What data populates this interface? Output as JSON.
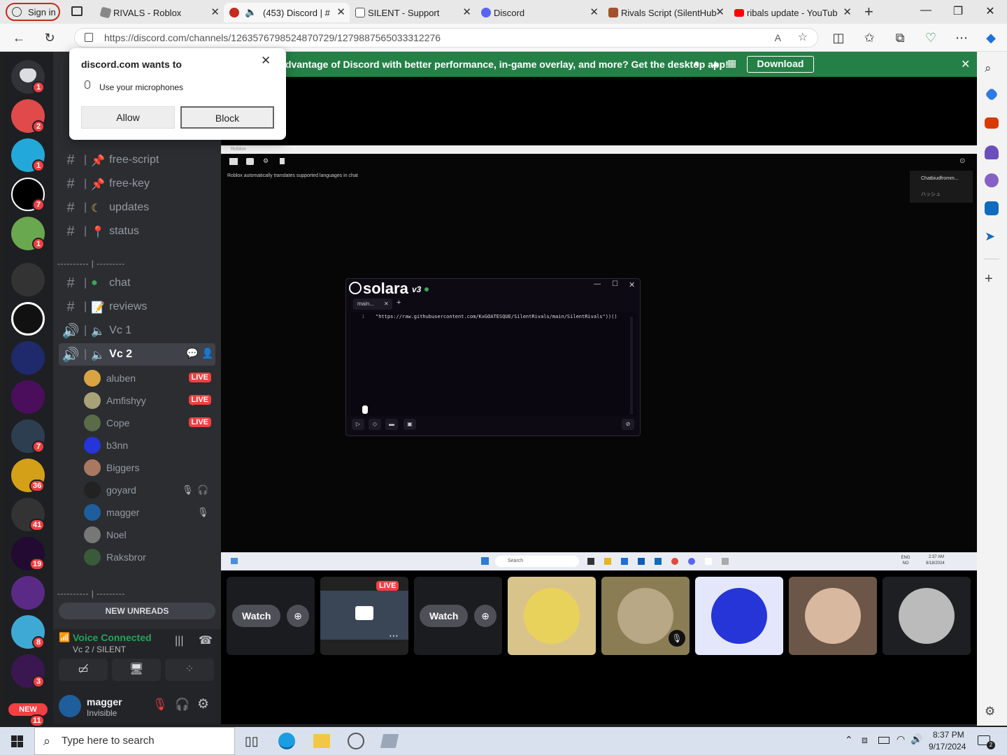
{
  "browser": {
    "signin_label": "Sign in",
    "tabs": [
      {
        "label": "RIVALS - Roblox",
        "color": "#666666"
      },
      {
        "label": "(453) Discord | #",
        "color": "#c42b1c"
      },
      {
        "label": "SILENT - Support",
        "color": "#555555"
      },
      {
        "label": "Discord",
        "color": "#5865f2"
      },
      {
        "label": "Rivals Script (SilentHub",
        "color": "#a0522d"
      },
      {
        "label": "ribals update - YouTub",
        "color": "#ff0000"
      }
    ],
    "url": "https://discord.com/channels/1263576798524870729/1279887565033312276"
  },
  "popup": {
    "title": "discord.com wants to",
    "permission": "Use your microphones",
    "allow_label": "Allow",
    "block_label": "Block"
  },
  "servers": {
    "badges": [
      "1",
      "2",
      "1",
      "7",
      "1",
      "7",
      "36",
      "41",
      "19",
      "8",
      "3",
      "11"
    ],
    "new_label": "NEW"
  },
  "channels": {
    "items": [
      {
        "name": "free-script"
      },
      {
        "name": "free-key"
      },
      {
        "name": "updates"
      },
      {
        "name": "status"
      },
      {
        "name": "chat"
      },
      {
        "name": "reviews"
      },
      {
        "name": "Vc 1"
      },
      {
        "name": "Vc 2"
      }
    ],
    "divider1": "---------- | ---------",
    "divider2": "---------- | ---------",
    "members": [
      {
        "name": "aluben",
        "live": "LIVE"
      },
      {
        "name": "Amfishyy",
        "live": "LIVE"
      },
      {
        "name": "Cope",
        "live": "LIVE"
      },
      {
        "name": "b3nn"
      },
      {
        "name": "Biggers"
      },
      {
        "name": "goyard"
      },
      {
        "name": "magger"
      },
      {
        "name": "Noel"
      },
      {
        "name": "Raksbror"
      }
    ],
    "new_unreads": "NEW UNREADS"
  },
  "voice": {
    "status": "Voice Connected",
    "channel": "Vc 2 / SILENT"
  },
  "user": {
    "name": "magger",
    "status": "Invisible"
  },
  "banner": {
    "text": "dvantage of Discord with better performance, in-game overlay, and more? Get the desktop app!",
    "download_label": "Download"
  },
  "stream": {
    "window_title": "Roblox",
    "translate_notice": "Roblox automatically translates supported languages in chat",
    "chat_tab": "Chatbiudfromm...",
    "chat_tab2": "ハッシュ",
    "solara_brand": "solara",
    "solara_version": "v3",
    "solara_tab": "main...",
    "solara_line_num": "1",
    "solara_code": "\"https://raw.githubusercontent.com/KxGOATESQUE/SilentRivals/main/SilentRivals\"))()",
    "inner_search": "Search",
    "inner_lang": "ENG NO",
    "inner_time": "2:37 AM",
    "inner_date": "9/18/2024"
  },
  "tiles": {
    "watch_label": "Watch",
    "live_label": "LIVE"
  },
  "taskbar": {
    "search_placeholder": "Type here to search",
    "time": "8:37 PM",
    "date": "9/17/2024",
    "notif_count": "2"
  }
}
